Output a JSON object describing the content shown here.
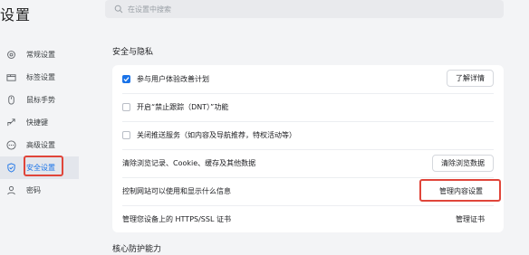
{
  "header": {
    "title": "设置",
    "search_placeholder": "在设置中搜索"
  },
  "sidebar": {
    "items": [
      {
        "label": "常规设置",
        "icon": "gear-icon"
      },
      {
        "label": "标签设置",
        "icon": "tab-icon"
      },
      {
        "label": "鼠标手势",
        "icon": "mouse-icon"
      },
      {
        "label": "快捷键",
        "icon": "shortcut-icon"
      },
      {
        "label": "高级设置",
        "icon": "more-icon"
      },
      {
        "label": "安全设置",
        "icon": "shield-icon"
      },
      {
        "label": "密码",
        "icon": "key-icon"
      }
    ]
  },
  "main": {
    "section_title": "安全与隐私",
    "rows": [
      {
        "label": "参与用户体验改善计划",
        "checkbox": true,
        "button": "了解详情"
      },
      {
        "label": "开启“禁止跟踪（DNT）”功能",
        "checkbox": false
      },
      {
        "label": "关闭推送服务（如内容及导航推荐，特权活动等）",
        "checkbox": false
      },
      {
        "label": "清除浏览记录、Cookie、缓存及其他数据",
        "button": "清除浏览数据"
      },
      {
        "label": "控制网站可以使用和显示什么信息",
        "button": "管理内容设置"
      },
      {
        "label": "管理您设备上的 HTTPS/SSL 证书",
        "button": "管理证书"
      }
    ],
    "next_section_title": "核心防护能力"
  },
  "colors": {
    "accent": "#1a73e8",
    "highlight": "#e0453a"
  }
}
